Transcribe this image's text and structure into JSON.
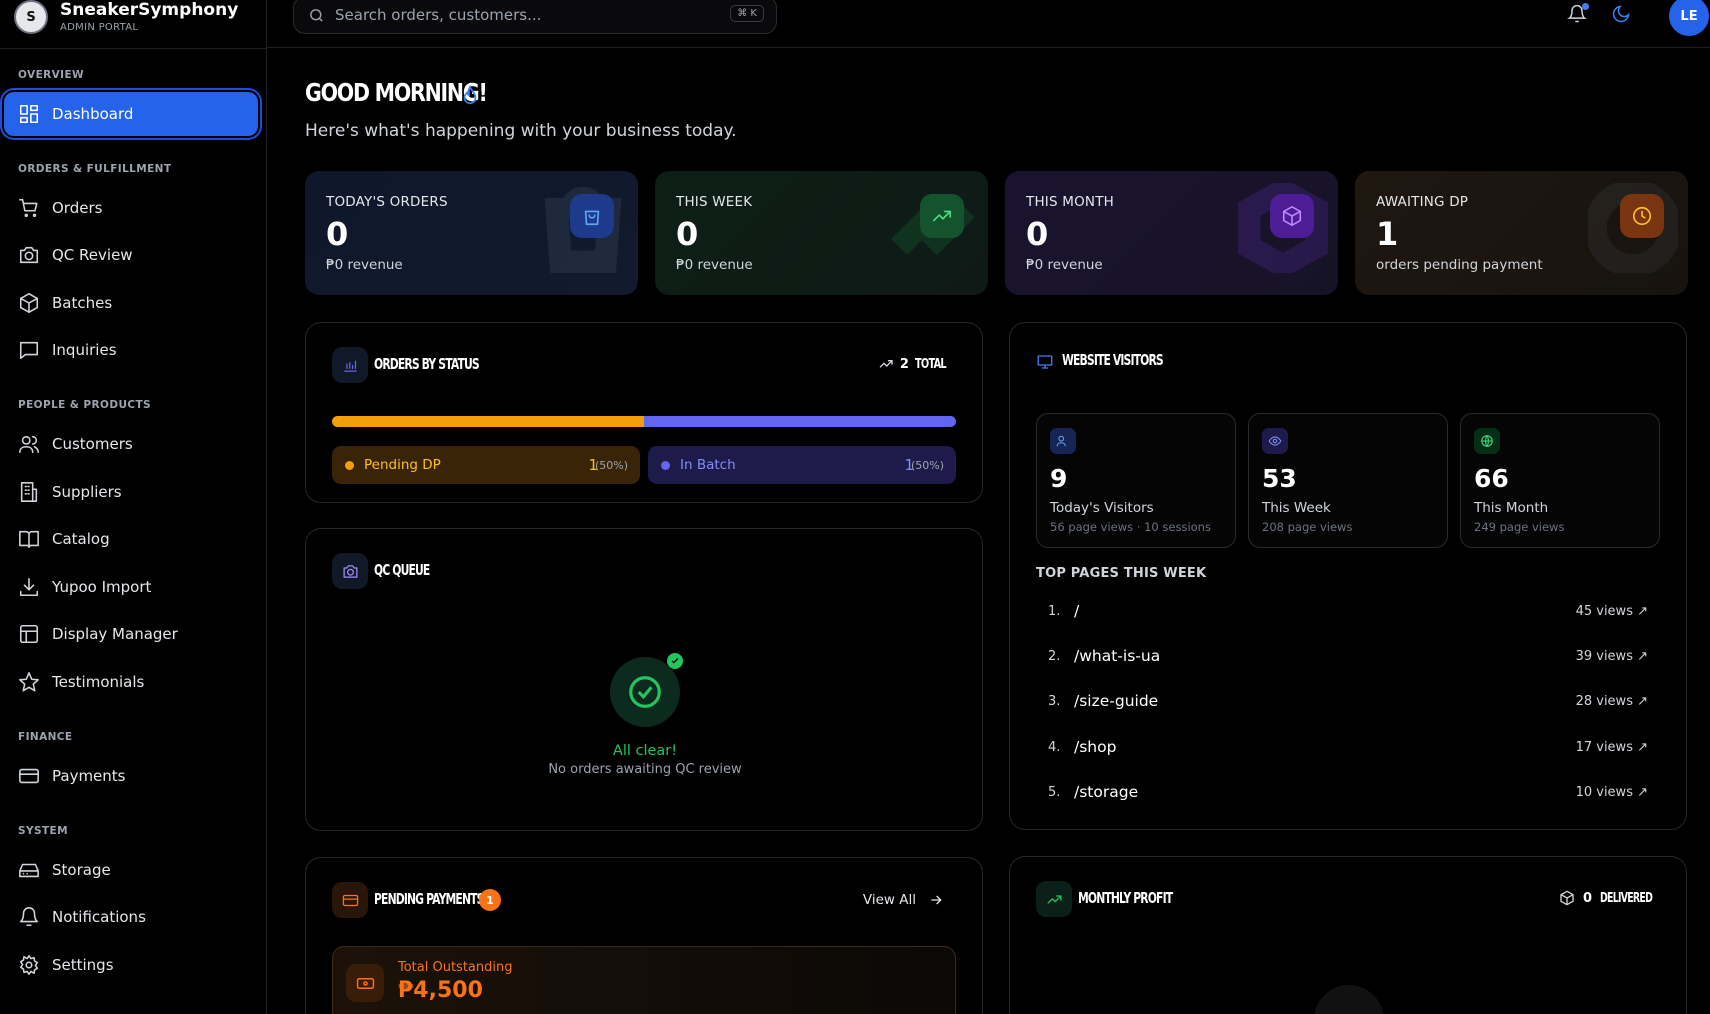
{
  "brand": {
    "name": "SneakerSymphony",
    "sub": "ADMIN PORTAL",
    "logo_text": "S"
  },
  "search": {
    "placeholder": "Search orders, customers...",
    "shortcut": "⌘ K"
  },
  "user": {
    "initials": "LE"
  },
  "sidebar": {
    "sections": [
      {
        "label": "OVERVIEW"
      },
      {
        "label": "ORDERS & FULFILLMENT"
      },
      {
        "label": "PEOPLE & PRODUCTS"
      },
      {
        "label": "FINANCE"
      },
      {
        "label": "SYSTEM"
      }
    ],
    "items": [
      {
        "label": "Dashboard",
        "icon": "grid-icon",
        "active": true
      },
      {
        "label": "Orders",
        "icon": "cart-icon"
      },
      {
        "label": "QC Review",
        "icon": "camera-icon"
      },
      {
        "label": "Batches",
        "icon": "box-icon"
      },
      {
        "label": "Inquiries",
        "icon": "message-icon"
      },
      {
        "label": "Customers",
        "icon": "users-icon"
      },
      {
        "label": "Suppliers",
        "icon": "building-icon"
      },
      {
        "label": "Catalog",
        "icon": "book-icon"
      },
      {
        "label": "Yupoo Import",
        "icon": "download-icon"
      },
      {
        "label": "Display Manager",
        "icon": "layout-icon"
      },
      {
        "label": "Testimonials",
        "icon": "star-icon"
      },
      {
        "label": "Payments",
        "icon": "credit-card-icon"
      },
      {
        "label": "Storage",
        "icon": "hard-drive-icon"
      },
      {
        "label": "Notifications",
        "icon": "bell-icon"
      },
      {
        "label": "Settings",
        "icon": "gear-icon"
      }
    ]
  },
  "greeting": {
    "title": "GOOD MORNING!",
    "subtitle": "Here's what's happening with your business today."
  },
  "stats": [
    {
      "label": "TODAY'S ORDERS",
      "value": "0",
      "sub": "₱0 revenue",
      "icon": "shopping-bag-icon",
      "color": "#3b82f6"
    },
    {
      "label": "THIS WEEK",
      "value": "0",
      "sub": "₱0 revenue",
      "icon": "trending-up-icon",
      "color": "#22c55e"
    },
    {
      "label": "THIS MONTH",
      "value": "0",
      "sub": "₱0 revenue",
      "icon": "package-icon",
      "color": "#a855f7"
    },
    {
      "label": "AWAITING DP",
      "value": "1",
      "sub": "orders pending payment",
      "icon": "clock-icon",
      "color": "#f59e0b"
    }
  ],
  "orders_by_status": {
    "title": "ORDERS BY STATUS",
    "total_count": "2",
    "total_label": "TOTAL",
    "statuses": [
      {
        "label": "Pending DP",
        "count": "1",
        "pct": "(50%)",
        "color": "#f59e0b",
        "fraction": 0.5
      },
      {
        "label": "In Batch",
        "count": "1",
        "pct": "(50%)",
        "color": "#6366f1",
        "fraction": 0.5
      }
    ]
  },
  "qc_queue": {
    "title": "QC QUEUE",
    "status": "All clear!",
    "message": "No orders awaiting QC review"
  },
  "visitors": {
    "title": "WEBSITE VISITORS",
    "cards": [
      {
        "value": "9",
        "label": "Today's Visitors",
        "sub": "56 page views · 10 sessions",
        "icon": "users-icon"
      },
      {
        "value": "53",
        "label": "This Week",
        "sub": "208 page views",
        "icon": "eye-icon"
      },
      {
        "value": "66",
        "label": "This Month",
        "sub": "249 page views",
        "icon": "globe-icon"
      }
    ],
    "top_pages_title": "TOP PAGES THIS WEEK",
    "top_pages": [
      {
        "rank": "1.",
        "path": "/",
        "views": "45 views ↗"
      },
      {
        "rank": "2.",
        "path": "/what-is-ua",
        "views": "39 views ↗"
      },
      {
        "rank": "3.",
        "path": "/size-guide",
        "views": "28 views ↗"
      },
      {
        "rank": "4.",
        "path": "/shop",
        "views": "17 views ↗"
      },
      {
        "rank": "5.",
        "path": "/storage",
        "views": "10 views ↗"
      }
    ]
  },
  "pending_payments": {
    "title": "PENDING PAYMENTS",
    "badge": "1",
    "view_all": "View All",
    "total_label": "Total Outstanding",
    "total_value": "₱4,500"
  },
  "monthly_profit": {
    "title": "MONTHLY PROFIT",
    "delivered_count": "0",
    "delivered_label": "DELIVERED"
  }
}
